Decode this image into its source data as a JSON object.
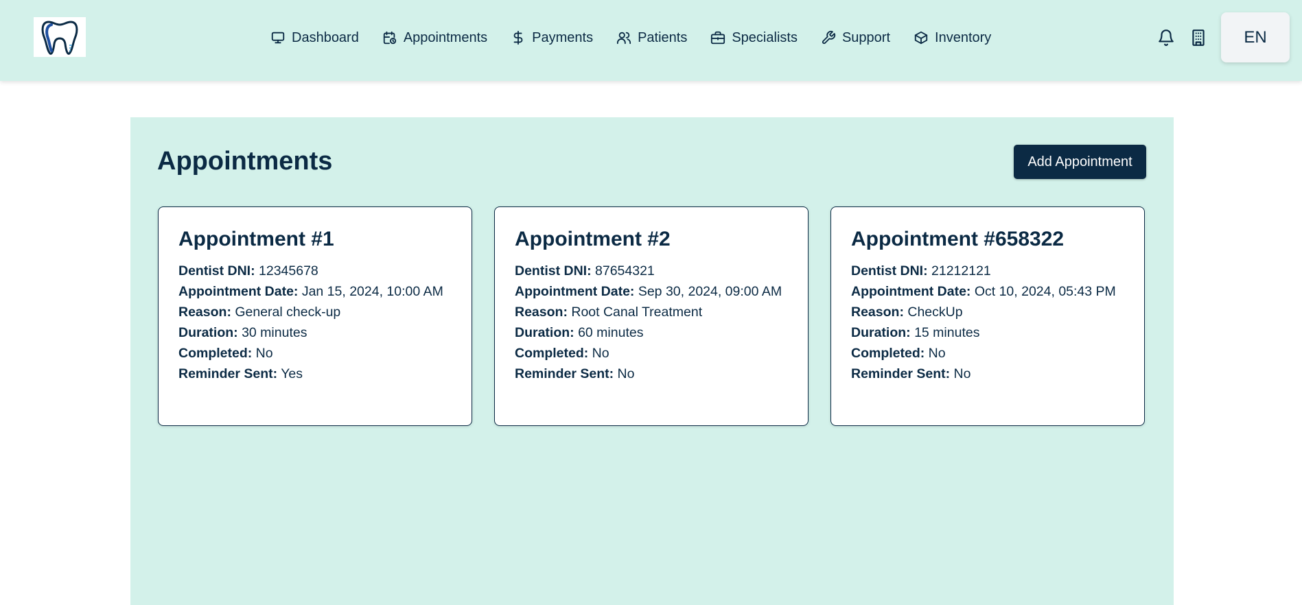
{
  "nav": {
    "items": [
      {
        "label": "Dashboard",
        "icon": "monitor-icon"
      },
      {
        "label": "Appointments",
        "icon": "calendar-clock-icon"
      },
      {
        "label": "Payments",
        "icon": "dollar-icon"
      },
      {
        "label": "Patients",
        "icon": "users-icon"
      },
      {
        "label": "Specialists",
        "icon": "briefcase-icon"
      },
      {
        "label": "Support",
        "icon": "wrench-icon"
      },
      {
        "label": "Inventory",
        "icon": "box-icon"
      }
    ],
    "notification_icon": "bell-icon",
    "building_icon": "building-icon",
    "language": "EN"
  },
  "page": {
    "title": "Appointments",
    "add_button_label": "Add Appointment"
  },
  "appointment_labels": {
    "dentist_dni": "Dentist DNI:",
    "date": "Appointment Date:",
    "reason": "Reason:",
    "duration": "Duration:",
    "completed": "Completed:",
    "reminder": "Reminder Sent:"
  },
  "appointments": [
    {
      "title": "Appointment #1",
      "dentist_dni": "12345678",
      "date": "Jan 15, 2024, 10:00 AM",
      "reason": "General check-up",
      "duration": "30 minutes",
      "completed": "No",
      "reminder": "Yes"
    },
    {
      "title": "Appointment #2",
      "dentist_dni": "87654321",
      "date": "Sep 30, 2024, 09:00 AM",
      "reason": "Root Canal Treatment",
      "duration": "60 minutes",
      "completed": "No",
      "reminder": "No"
    },
    {
      "title": "Appointment #658322",
      "dentist_dni": "21212121",
      "date": "Oct 10, 2024, 05:43 PM",
      "reason": "CheckUp",
      "duration": "15 minutes",
      "completed": "No",
      "reminder": "No"
    }
  ],
  "colors": {
    "header_bg": "#d3f1ea",
    "primary": "#0b2a44",
    "logo_blue": "#1e4fa0"
  }
}
